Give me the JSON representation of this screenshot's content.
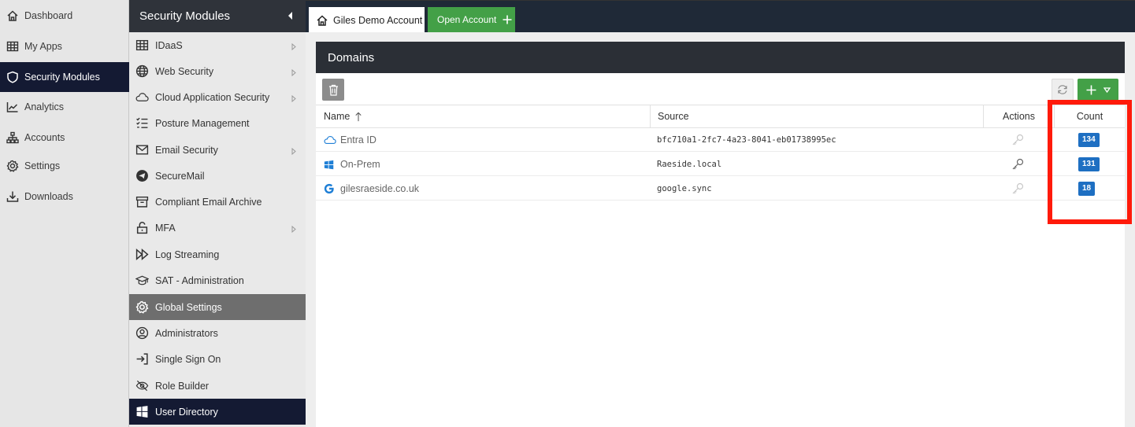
{
  "primary_nav": {
    "items": [
      {
        "label": "Dashboard",
        "icon": "home-icon"
      },
      {
        "label": "My Apps",
        "icon": "grid-icon"
      },
      {
        "label": "Security Modules",
        "icon": "shield-icon"
      },
      {
        "label": "Analytics",
        "icon": "chart-icon"
      },
      {
        "label": "Accounts",
        "icon": "org-chart-icon"
      },
      {
        "label": "Settings",
        "icon": "gear-icon"
      },
      {
        "label": "Downloads",
        "icon": "download-icon"
      }
    ]
  },
  "secondary_nav": {
    "title": "Security Modules",
    "items": [
      {
        "label": "IDaaS",
        "icon": "table-icon"
      },
      {
        "label": "Web Security",
        "icon": "globe-icon"
      },
      {
        "label": "Cloud Application Security",
        "icon": "cloud-icon"
      },
      {
        "label": "Posture Management",
        "icon": "checklist-icon"
      },
      {
        "label": "Email Security",
        "icon": "envelope-icon"
      },
      {
        "label": "SecureMail",
        "icon": "send-icon"
      },
      {
        "label": "Compliant Email Archive",
        "icon": "archive-icon"
      },
      {
        "label": "MFA",
        "icon": "unlock-icon"
      },
      {
        "label": "Log Streaming",
        "icon": "fast-forward-icon"
      },
      {
        "label": "SAT - Administration",
        "icon": "graduation-cap-icon"
      },
      {
        "label": "Global Settings",
        "icon": "gear-icon"
      },
      {
        "label": "Administrators",
        "icon": "user-circle-icon"
      },
      {
        "label": "Single Sign On",
        "icon": "sign-in-icon"
      },
      {
        "label": "Role Builder",
        "icon": "eye-slash-icon"
      },
      {
        "label": "User Directory",
        "icon": "windows-icon"
      }
    ]
  },
  "tabs": {
    "account_label": "Giles Demo Account",
    "open_account_label": "Open Account"
  },
  "panel": {
    "title": "Domains"
  },
  "table": {
    "columns": {
      "name": "Name",
      "source": "Source",
      "actions": "Actions",
      "count": "Count"
    },
    "rows": [
      {
        "name": "Entra ID",
        "source": "bfc710a1-2fc7-4a23-8041-eb01738995ec",
        "count": "134",
        "icon": "cloud-icon"
      },
      {
        "name": "On-Prem",
        "source": "Raeside.local",
        "count": "131",
        "icon": "windows-icon"
      },
      {
        "name": "gilesraeside.co.uk",
        "source": "google.sync",
        "count": "18",
        "icon": "google-icon"
      }
    ]
  },
  "colors": {
    "nav_active": "#141a33",
    "accent_green": "#43a047",
    "badge_blue": "#1e6fc2",
    "highlight_red": "#ff1a0a"
  }
}
